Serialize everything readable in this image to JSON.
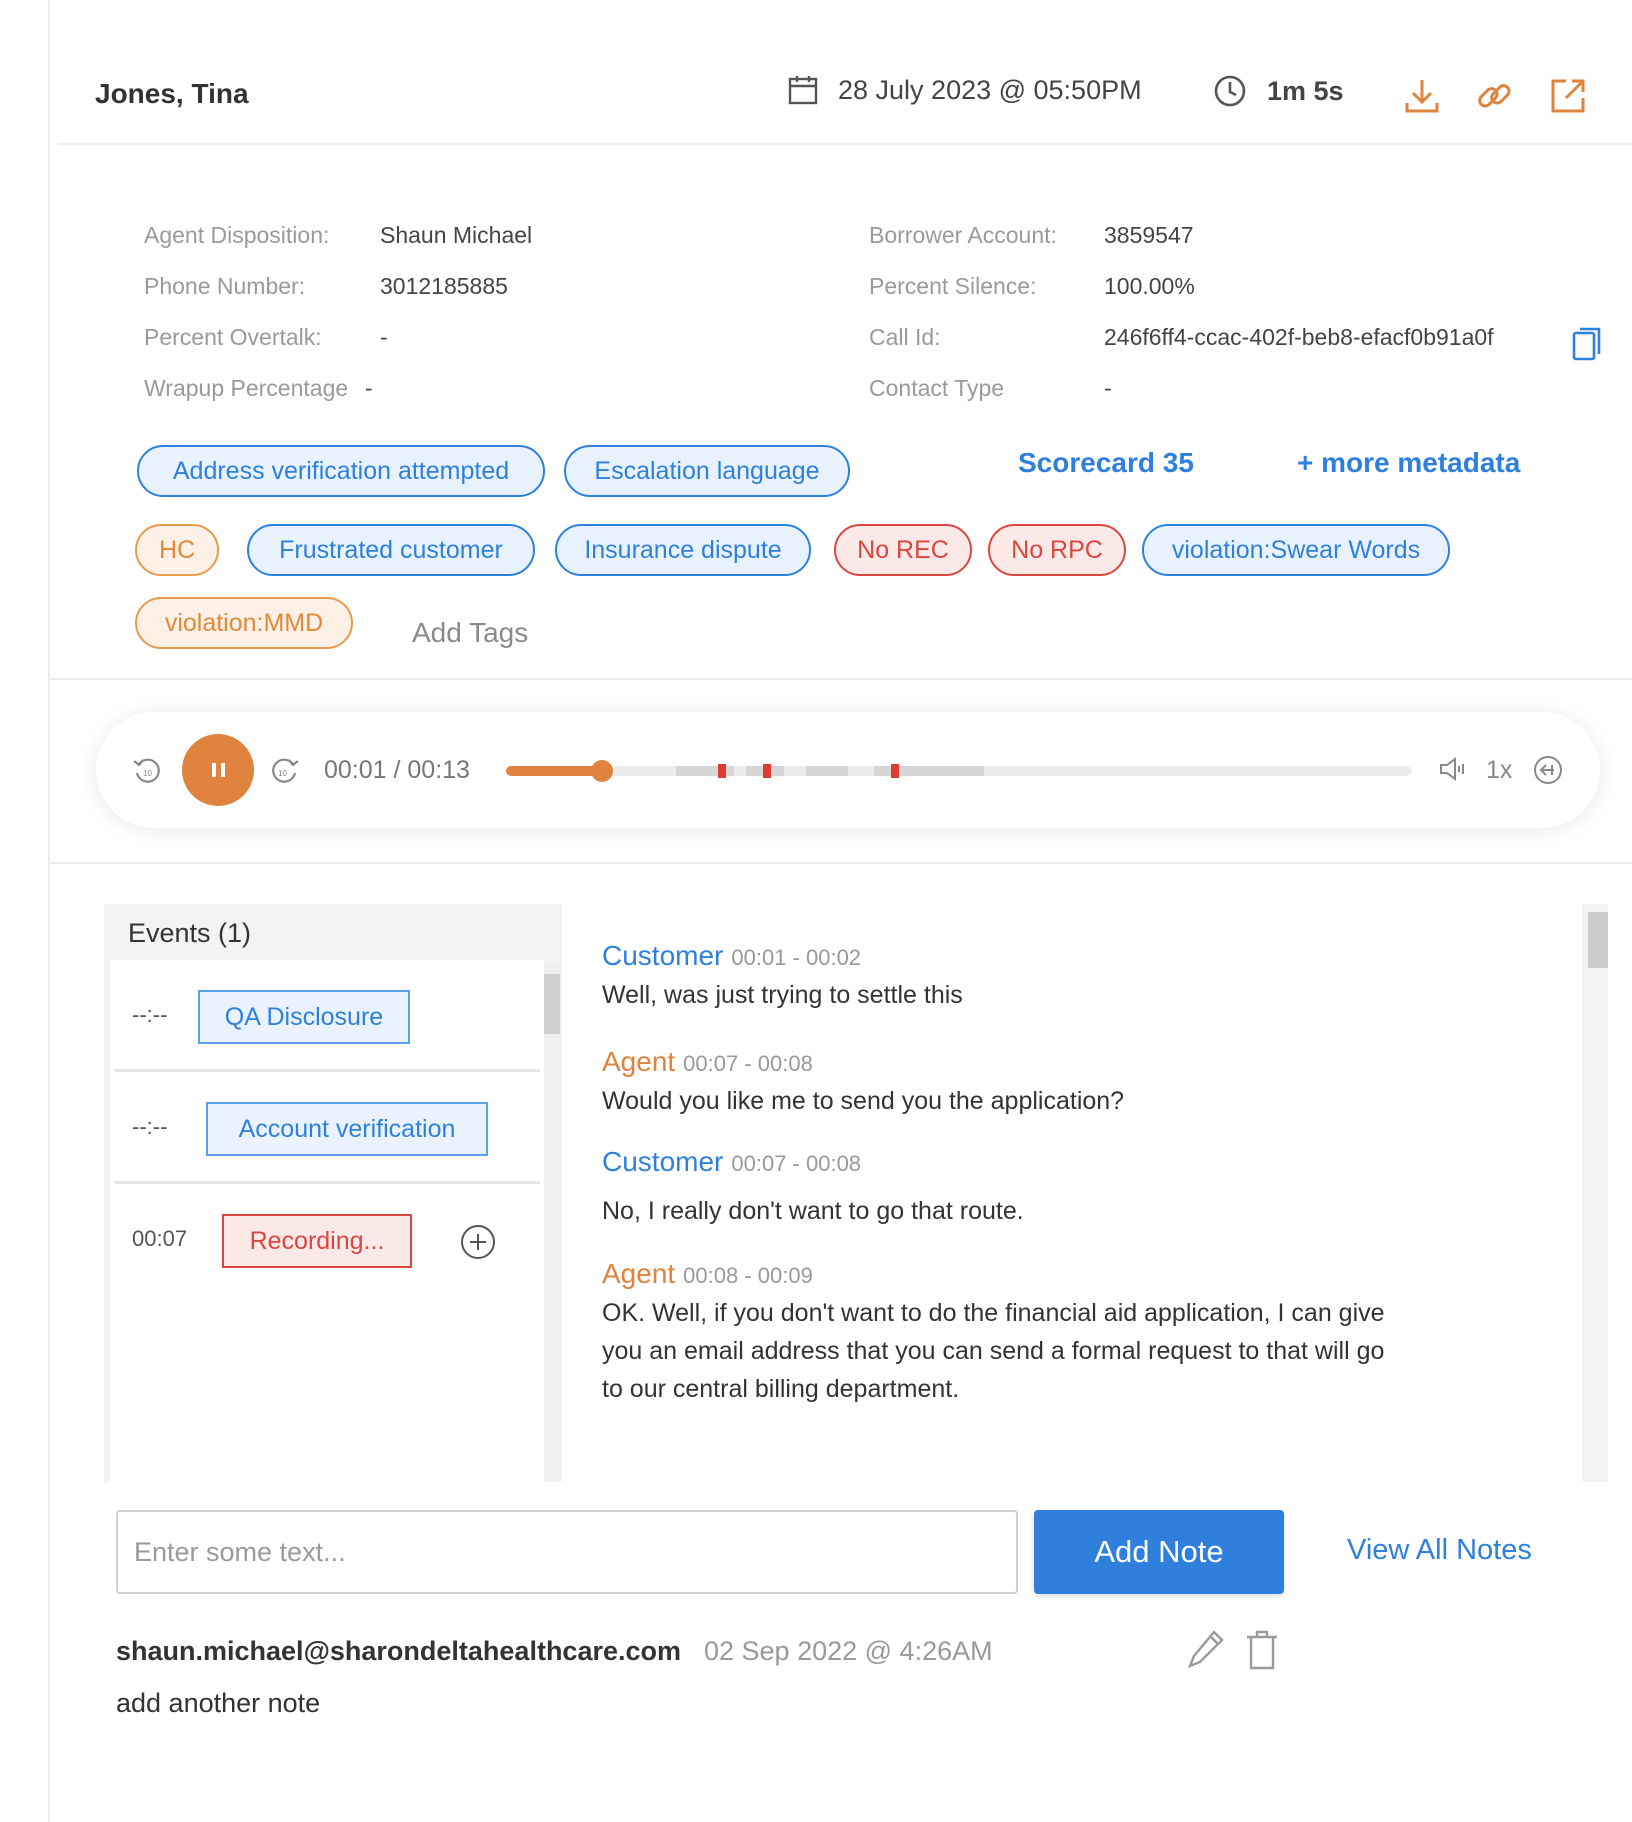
{
  "header": {
    "name": "Jones, Tina",
    "date": "28 July 2023 @ 05:50PM",
    "duration": "1m 5s",
    "actions": [
      "download-icon",
      "link-icon",
      "open-external-icon"
    ]
  },
  "metadata_left": [
    {
      "label": "Agent Disposition:",
      "value": "Shaun Michael"
    },
    {
      "label": "Phone Number:",
      "value": "3012185885"
    },
    {
      "label": "Percent Overtalk:",
      "value": "-"
    },
    {
      "label": "Wrapup Percentage",
      "value": "-"
    }
  ],
  "metadata_right": [
    {
      "label": "Borrower Account:",
      "value": "3859547"
    },
    {
      "label": "Percent Silence:",
      "value": "100.00%"
    },
    {
      "label": "Call Id:",
      "value": "246f6ff4-ccac-402f-beb8-efacf0b91a0f"
    },
    {
      "label": "Contact Type",
      "value": "-"
    }
  ],
  "tags": [
    {
      "label": "Address verification attempted",
      "color": "blue"
    },
    {
      "label": "Escalation language",
      "color": "blue"
    },
    {
      "label": "HC",
      "color": "orange"
    },
    {
      "label": "Frustrated customer",
      "color": "blue"
    },
    {
      "label": "Insurance dispute",
      "color": "blue"
    },
    {
      "label": "No REC",
      "color": "red"
    },
    {
      "label": "No RPC",
      "color": "red"
    },
    {
      "label": "violation:Swear Words",
      "color": "blue"
    },
    {
      "label": "violation:MMD",
      "color": "orange"
    }
  ],
  "scorecard_link": "Scorecard 35",
  "more_metadata_link": "+ more metadata",
  "add_tags": "Add Tags",
  "player": {
    "time": "00:01 / 00:13",
    "speed": "1x",
    "progress": 0.08,
    "state": "playing"
  },
  "events": {
    "title": "Events (1)",
    "items": [
      {
        "time": "--:--",
        "label": "QA Disclosure",
        "color": "blue"
      },
      {
        "time": "--:--",
        "label": "Account verification",
        "color": "blue"
      },
      {
        "time": "00:07",
        "label": "Recording...",
        "color": "red"
      }
    ]
  },
  "transcript": [
    {
      "speaker": "Customer",
      "time": "00:01 - 00:02",
      "text": "Well, was just trying to settle this"
    },
    {
      "speaker": "Agent",
      "time": "00:07 - 00:08",
      "text": "Would you like me to send you the application?"
    },
    {
      "speaker": "Customer",
      "time": "00:07 - 00:08",
      "text": "No, I really don't want to go that route."
    },
    {
      "speaker": "Agent",
      "time": "00:08 - 00:09",
      "text": "OK. Well, if you don't want to do the financial aid application, I can give you an email address that you can send a formal request to that will go to our central billing department."
    }
  ],
  "notes": {
    "placeholder": "Enter some text...",
    "add_button": "Add Note",
    "view_all": "View All Notes",
    "items": [
      {
        "author": "shaun.michael@sharondeltahealthcare.com",
        "date": "02 Sep 2022 @ 4:26AM",
        "text": "add another note"
      }
    ]
  },
  "colors": {
    "accent_blue": "#2f80dd",
    "accent_orange": "#e0833f",
    "alert_red": "#dc4640"
  }
}
